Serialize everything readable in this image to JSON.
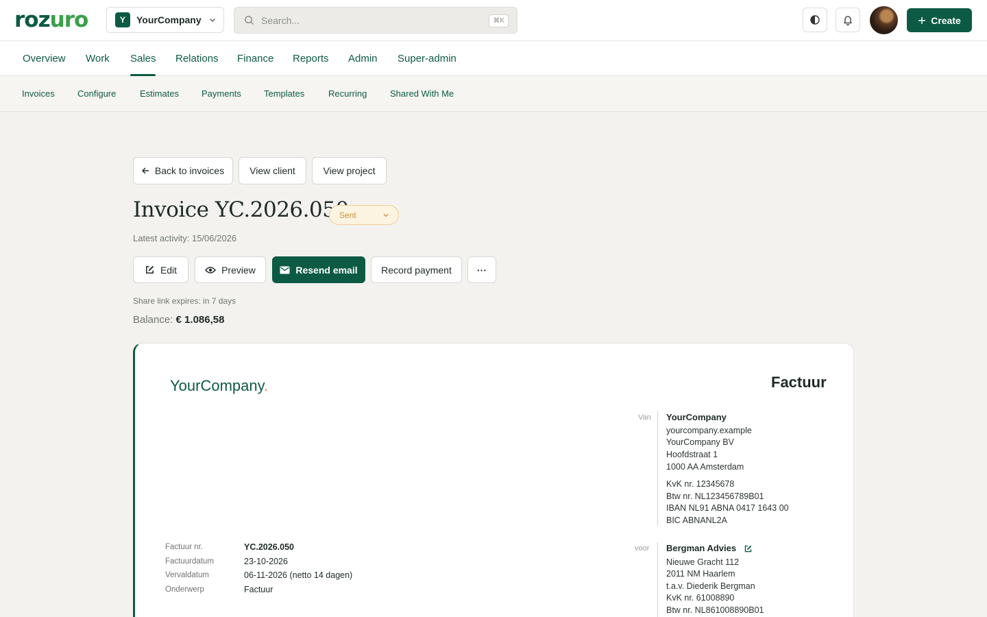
{
  "app": {
    "logo_part1": "roz",
    "logo_part2": "uro",
    "company_initial": "Y",
    "company_name": "YourCompany",
    "search_placeholder": "Search...",
    "search_shortcut": "⌘K",
    "create_label": "Create",
    "icons": [
      "chevron-down-icon",
      "search-icon",
      "theme-toggle-icon",
      "bell-icon",
      "plus-icon"
    ]
  },
  "main_nav": [
    "Overview",
    "Work",
    "Sales",
    "Relations",
    "Finance",
    "Reports",
    "Admin",
    "Super-admin"
  ],
  "main_nav_active": "Sales",
  "sub_nav": [
    "Invoices",
    "Configure",
    "Estimates",
    "Payments",
    "Templates",
    "Recurring",
    "Shared With Me"
  ],
  "links": {
    "back": "Back to invoices",
    "view_client": "View client",
    "view_project": "View project"
  },
  "invoice": {
    "title": "Invoice YC.2026.050",
    "status": "Sent",
    "latest_activity": "Latest activity: 15/06/2026",
    "share_link": "Share link expires: in 7 days",
    "balance_label": "Balance:",
    "balance_value": "€ 1.086,58"
  },
  "actions": {
    "edit": "Edit",
    "preview": "Preview",
    "resend": "Resend email",
    "record_payment": "Record payment",
    "more": "···"
  },
  "colors": {
    "brand": "#0d5a44",
    "brand_light": "#3aa04a",
    "status_bg": "#fdf3e1",
    "status_text": "#c8913a",
    "accent_dot": "#e08a2c"
  },
  "document": {
    "brand_name": "YourCompany",
    "brand_dot": ".",
    "title": "Factuur",
    "from_label": "Van",
    "from": {
      "name": "YourCompany",
      "lines": [
        "yourcompany.example",
        "YourCompany BV",
        "Hoofdstraat 1",
        "1000 AA Amsterdam"
      ],
      "legal": [
        "KvK nr. 12345678",
        "Btw nr. NL123456789B01",
        "IBAN NL91 ABNA 0417 1643 00",
        "BIC ABNANL2A"
      ]
    },
    "to_label": "voor",
    "to": {
      "name": "Bergman Advies",
      "lines": [
        "Nieuwe Gracht 112",
        "2011 NM Haarlem",
        "t.a.v. Diederik Bergman",
        "KvK nr. 61008890",
        "Btw nr. NL861008890B01"
      ]
    },
    "meta": [
      {
        "label": "Factuur nr.",
        "value": "YC.2026.050"
      },
      {
        "label": "Factuurdatum",
        "value": "23-10-2026"
      },
      {
        "label": "Vervaldatum",
        "value": "06-11-2026 (netto 14 dagen)"
      },
      {
        "label": "Onderwerp",
        "value": "Factuur"
      }
    ]
  }
}
